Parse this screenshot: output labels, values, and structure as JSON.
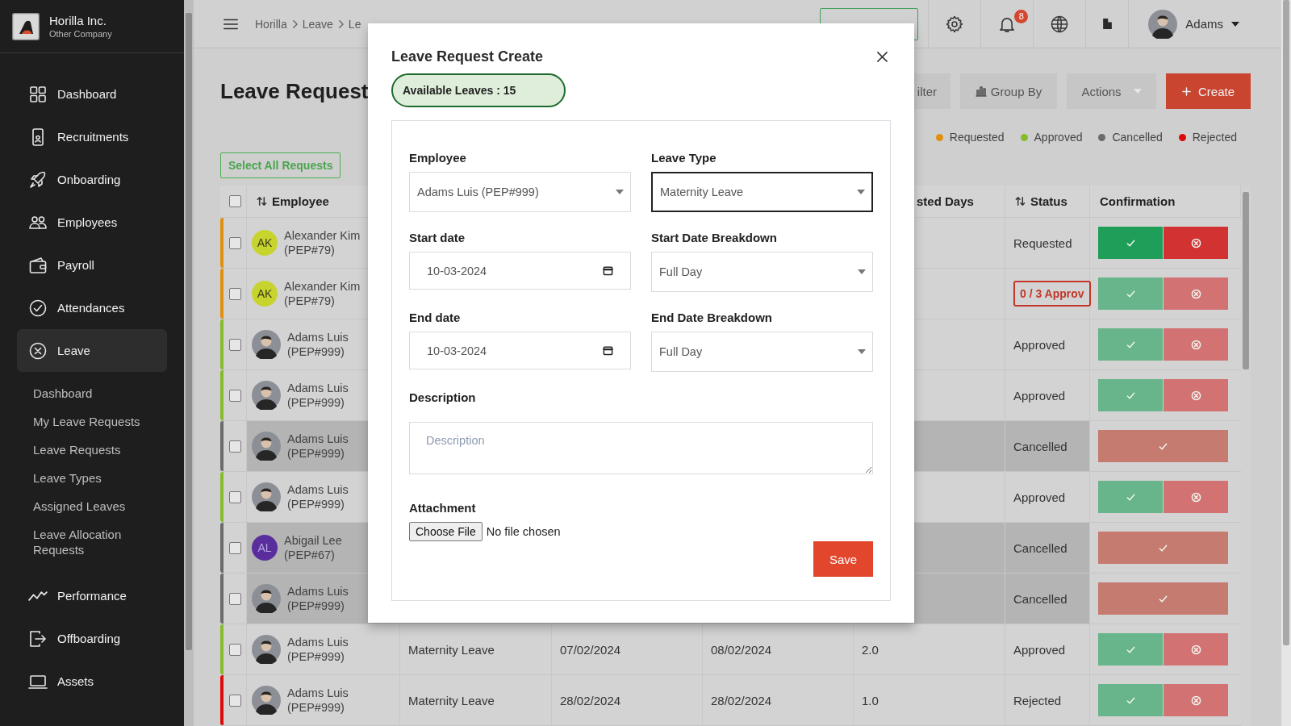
{
  "sidebar": {
    "company": {
      "name": "Horilla Inc.",
      "subtitle": "Other Company"
    },
    "items": [
      {
        "label": "Dashboard",
        "selected": false
      },
      {
        "label": "Recruitments",
        "selected": false
      },
      {
        "label": "Onboarding",
        "selected": false
      },
      {
        "label": "Employees",
        "selected": false
      },
      {
        "label": "Payroll",
        "selected": false
      },
      {
        "label": "Attendances",
        "selected": false
      },
      {
        "label": "Leave",
        "selected": true,
        "children": [
          {
            "label": "Dashboard"
          },
          {
            "label": "My Leave Requests"
          },
          {
            "label": "Leave Requests"
          },
          {
            "label": "Leave Types"
          },
          {
            "label": "Assigned Leaves"
          },
          {
            "label": "Leave Allocation Requests"
          }
        ]
      },
      {
        "label": "Performance",
        "selected": false
      },
      {
        "label": "Offboarding",
        "selected": false
      },
      {
        "label": "Assets",
        "selected": false
      }
    ]
  },
  "topbar": {
    "breadcrumbs": [
      "Horilla",
      "Leave",
      "Le"
    ],
    "notifications": "8",
    "user": "Adams"
  },
  "page": {
    "title": "Leave Request",
    "toolbar": [
      {
        "label": "ilter",
        "kind": "plain"
      },
      {
        "label": "Group By",
        "kind": "group"
      },
      {
        "label": "Actions",
        "kind": "menu"
      },
      {
        "label": "Create",
        "kind": "primary"
      }
    ],
    "legend": [
      {
        "label": "Requested",
        "color": "#e0900f"
      },
      {
        "label": "Approved",
        "color": "#86bb2c"
      },
      {
        "label": "Cancelled",
        "color": "#6b6b6b"
      },
      {
        "label": "Rejected",
        "color": "#dd0a0a"
      }
    ],
    "select_all": "Select All Requests"
  },
  "table": {
    "columns": [
      {
        "label": "Employee",
        "sortable": true
      },
      {
        "label": "sted Days",
        "sortable": false
      },
      {
        "label": "Status",
        "sortable": true
      },
      {
        "label": "Confirmation",
        "sortable": false
      }
    ],
    "header_checked": false,
    "rows": [
      {
        "color": "#e0900f",
        "checked": false,
        "shaded": false,
        "avatar": {
          "kind": "initials",
          "text": "AK",
          "color": "#c8d42e"
        },
        "name": "Alexander Kim",
        "code": "(PEP#79)",
        "status": {
          "kind": "text",
          "label": "Requested"
        },
        "confirmation": {
          "kind": "pair",
          "disabled": false
        }
      },
      {
        "color": "#e0900f",
        "checked": false,
        "shaded": false,
        "avatar": {
          "kind": "initials",
          "text": "AK",
          "color": "#c8d42e"
        },
        "name": "Alexander Kim",
        "code": "(PEP#79)",
        "status": {
          "kind": "badge",
          "label": "0 / 3 Approv"
        },
        "confirmation": {
          "kind": "pair",
          "disabled": true
        }
      },
      {
        "color": "#86bb2c",
        "checked": false,
        "shaded": false,
        "avatar": {
          "kind": "photo"
        },
        "name": "Adams Luis",
        "code": "(PEP#999)",
        "status": {
          "kind": "text",
          "label": "Approved"
        },
        "confirmation": {
          "kind": "pair",
          "disabled": true
        }
      },
      {
        "color": "#86bb2c",
        "checked": false,
        "shaded": false,
        "avatar": {
          "kind": "photo"
        },
        "name": "Adams Luis",
        "code": "(PEP#999)",
        "status": {
          "kind": "text",
          "label": "Approved"
        },
        "confirmation": {
          "kind": "pair",
          "disabled": true
        }
      },
      {
        "color": "#6b6b6b",
        "checked": false,
        "shaded": true,
        "avatar": {
          "kind": "photo"
        },
        "name": "Adams Luis",
        "code": "(PEP#999)",
        "status": {
          "kind": "text",
          "label": "Cancelled"
        },
        "confirmation": {
          "kind": "single",
          "disabled": true
        }
      },
      {
        "color": "#86bb2c",
        "checked": false,
        "shaded": false,
        "avatar": {
          "kind": "photo"
        },
        "name": "Adams Luis",
        "code": "(PEP#999)",
        "status": {
          "kind": "text",
          "label": "Approved"
        },
        "confirmation": {
          "kind": "pair",
          "disabled": true
        }
      },
      {
        "color": "#6b6b6b",
        "checked": false,
        "shaded": true,
        "avatar": {
          "kind": "initials",
          "text": "AL",
          "color": "#5a2d9c"
        },
        "name": "Abigail Lee",
        "code": "(PEP#67)",
        "status": {
          "kind": "text",
          "label": "Cancelled"
        },
        "confirmation": {
          "kind": "single",
          "disabled": true
        }
      },
      {
        "color": "#6b6b6b",
        "checked": false,
        "shaded": true,
        "avatar": {
          "kind": "photo"
        },
        "name": "Adams Luis",
        "code": "(PEP#999)",
        "status": {
          "kind": "text",
          "label": "Cancelled"
        },
        "confirmation": {
          "kind": "single",
          "disabled": true
        }
      },
      {
        "color": "#86bb2c",
        "checked": false,
        "shaded": false,
        "avatar": {
          "kind": "photo"
        },
        "name": "Adams Luis",
        "code": "(PEP#999)",
        "leave_type": "Maternity Leave",
        "start": "07/02/2024",
        "end": "08/02/2024",
        "days": "2.0",
        "status": {
          "kind": "text",
          "label": "Approved"
        },
        "confirmation": {
          "kind": "pair",
          "disabled": true
        }
      },
      {
        "color": "#dd0a0a",
        "checked": false,
        "shaded": false,
        "avatar": {
          "kind": "photo"
        },
        "name": "Adams Luis",
        "code": "(PEP#999)",
        "leave_type": "Maternity Leave",
        "start": "28/02/2024",
        "end": "28/02/2024",
        "days": "1.0",
        "status": {
          "kind": "text",
          "label": "Rejected"
        },
        "confirmation": {
          "kind": "pair",
          "disabled": true
        }
      }
    ]
  },
  "modal": {
    "title": "Leave Request Create",
    "available": "Available Leaves : 15",
    "fields": [
      {
        "label": "Employee",
        "kind": "select",
        "value": "Adams Luis (PEP#999)",
        "focused": false
      },
      {
        "label": "Leave Type",
        "kind": "select",
        "value": "Maternity Leave",
        "focused": true
      },
      {
        "label": "Start date",
        "kind": "date",
        "value": "10-03-2024",
        "focused": false
      },
      {
        "label": "Start Date Breakdown",
        "kind": "select",
        "value": "Full Day",
        "focused": false
      },
      {
        "label": "End date",
        "kind": "date",
        "value": "10-03-2024",
        "focused": false
      },
      {
        "label": "End Date Breakdown",
        "kind": "select",
        "value": "Full Day",
        "focused": false
      },
      {
        "label": "Description",
        "kind": "textarea",
        "placeholder": "Description"
      },
      {
        "label": "Attachment",
        "kind": "file",
        "button": "Choose File",
        "status": "No file chosen"
      }
    ],
    "submit": "Save"
  }
}
